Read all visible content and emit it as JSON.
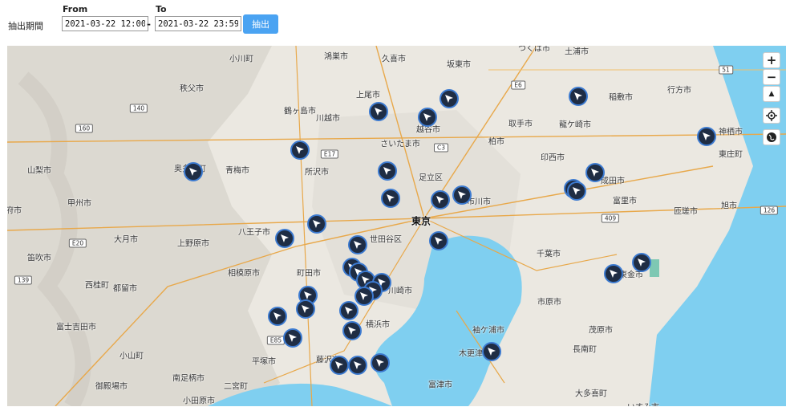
{
  "filter": {
    "period_label": "抽出期間",
    "from_label": "From",
    "to_label": "To",
    "from_value": "2021-03-22 12:00",
    "to_value": "2021-03-22 23:59",
    "separator": "-",
    "extract_button": "抽出"
  },
  "map": {
    "colors": {
      "land": "#ebe8e1",
      "water": "#7fcff0",
      "terrain": "#d9d6cf",
      "marker_fill": "#1f2d44",
      "marker_ring": "#3c7ad0",
      "urban": "#e2dfd8"
    },
    "controls": {
      "zoom_in": "+",
      "zoom_out": "−",
      "compass": "▲",
      "locate_icon": "locate-icon",
      "globe_icon": "globe-icon"
    },
    "places": [
      {
        "name": "小川町"
      },
      {
        "name": "鴻巣市"
      },
      {
        "name": "久喜市"
      },
      {
        "name": "坂東市"
      },
      {
        "name": "つくば市"
      },
      {
        "name": "土浦市"
      },
      {
        "name": "秩父市"
      },
      {
        "name": "上尾市"
      },
      {
        "name": "行方市"
      },
      {
        "name": "鶴ヶ島市"
      },
      {
        "name": "川越市"
      },
      {
        "name": "稲敷市"
      },
      {
        "name": "越谷市"
      },
      {
        "name": "取手市"
      },
      {
        "name": "龍ケ崎市"
      },
      {
        "name": "神栖市"
      },
      {
        "name": "さいたま市"
      },
      {
        "name": "柏市"
      },
      {
        "name": "東庄町"
      },
      {
        "name": "山梨市"
      },
      {
        "name": "奥多摩町"
      },
      {
        "name": "青梅市"
      },
      {
        "name": "所沢市"
      },
      {
        "name": "足立区"
      },
      {
        "name": "印西市"
      },
      {
        "name": "成田市"
      },
      {
        "name": "甲州市"
      },
      {
        "name": "市川市"
      },
      {
        "name": "富里市"
      },
      {
        "name": "府市"
      },
      {
        "name": "東京",
        "major": true
      },
      {
        "name": "匝瑳市"
      },
      {
        "name": "旭市"
      },
      {
        "name": "八王子市"
      },
      {
        "name": "大月市"
      },
      {
        "name": "上野原市"
      },
      {
        "name": "世田谷区"
      },
      {
        "name": "笛吹市"
      },
      {
        "name": "千葉市"
      },
      {
        "name": "相模原市"
      },
      {
        "name": "町田市"
      },
      {
        "name": "西桂町"
      },
      {
        "name": "都留市"
      },
      {
        "name": "東金市"
      },
      {
        "name": "川崎市"
      },
      {
        "name": "市原市"
      },
      {
        "name": "富士吉田市"
      },
      {
        "name": "横浜市"
      },
      {
        "name": "袖ケ浦市"
      },
      {
        "name": "茂原市"
      },
      {
        "name": "小山町"
      },
      {
        "name": "平塚市"
      },
      {
        "name": "藤沢市"
      },
      {
        "name": "木更津市"
      },
      {
        "name": "長南町"
      },
      {
        "name": "南足柄市"
      },
      {
        "name": "御殿場市"
      },
      {
        "name": "二宮町"
      },
      {
        "name": "富津市"
      },
      {
        "name": "小田原市"
      },
      {
        "name": "大多喜町"
      },
      {
        "name": "いすみ市"
      }
    ],
    "shields": [
      "51",
      "E6",
      "140",
      "160",
      "E17",
      "C3",
      "E20",
      "409",
      "126",
      "139",
      "E85"
    ],
    "markers": 46
  }
}
